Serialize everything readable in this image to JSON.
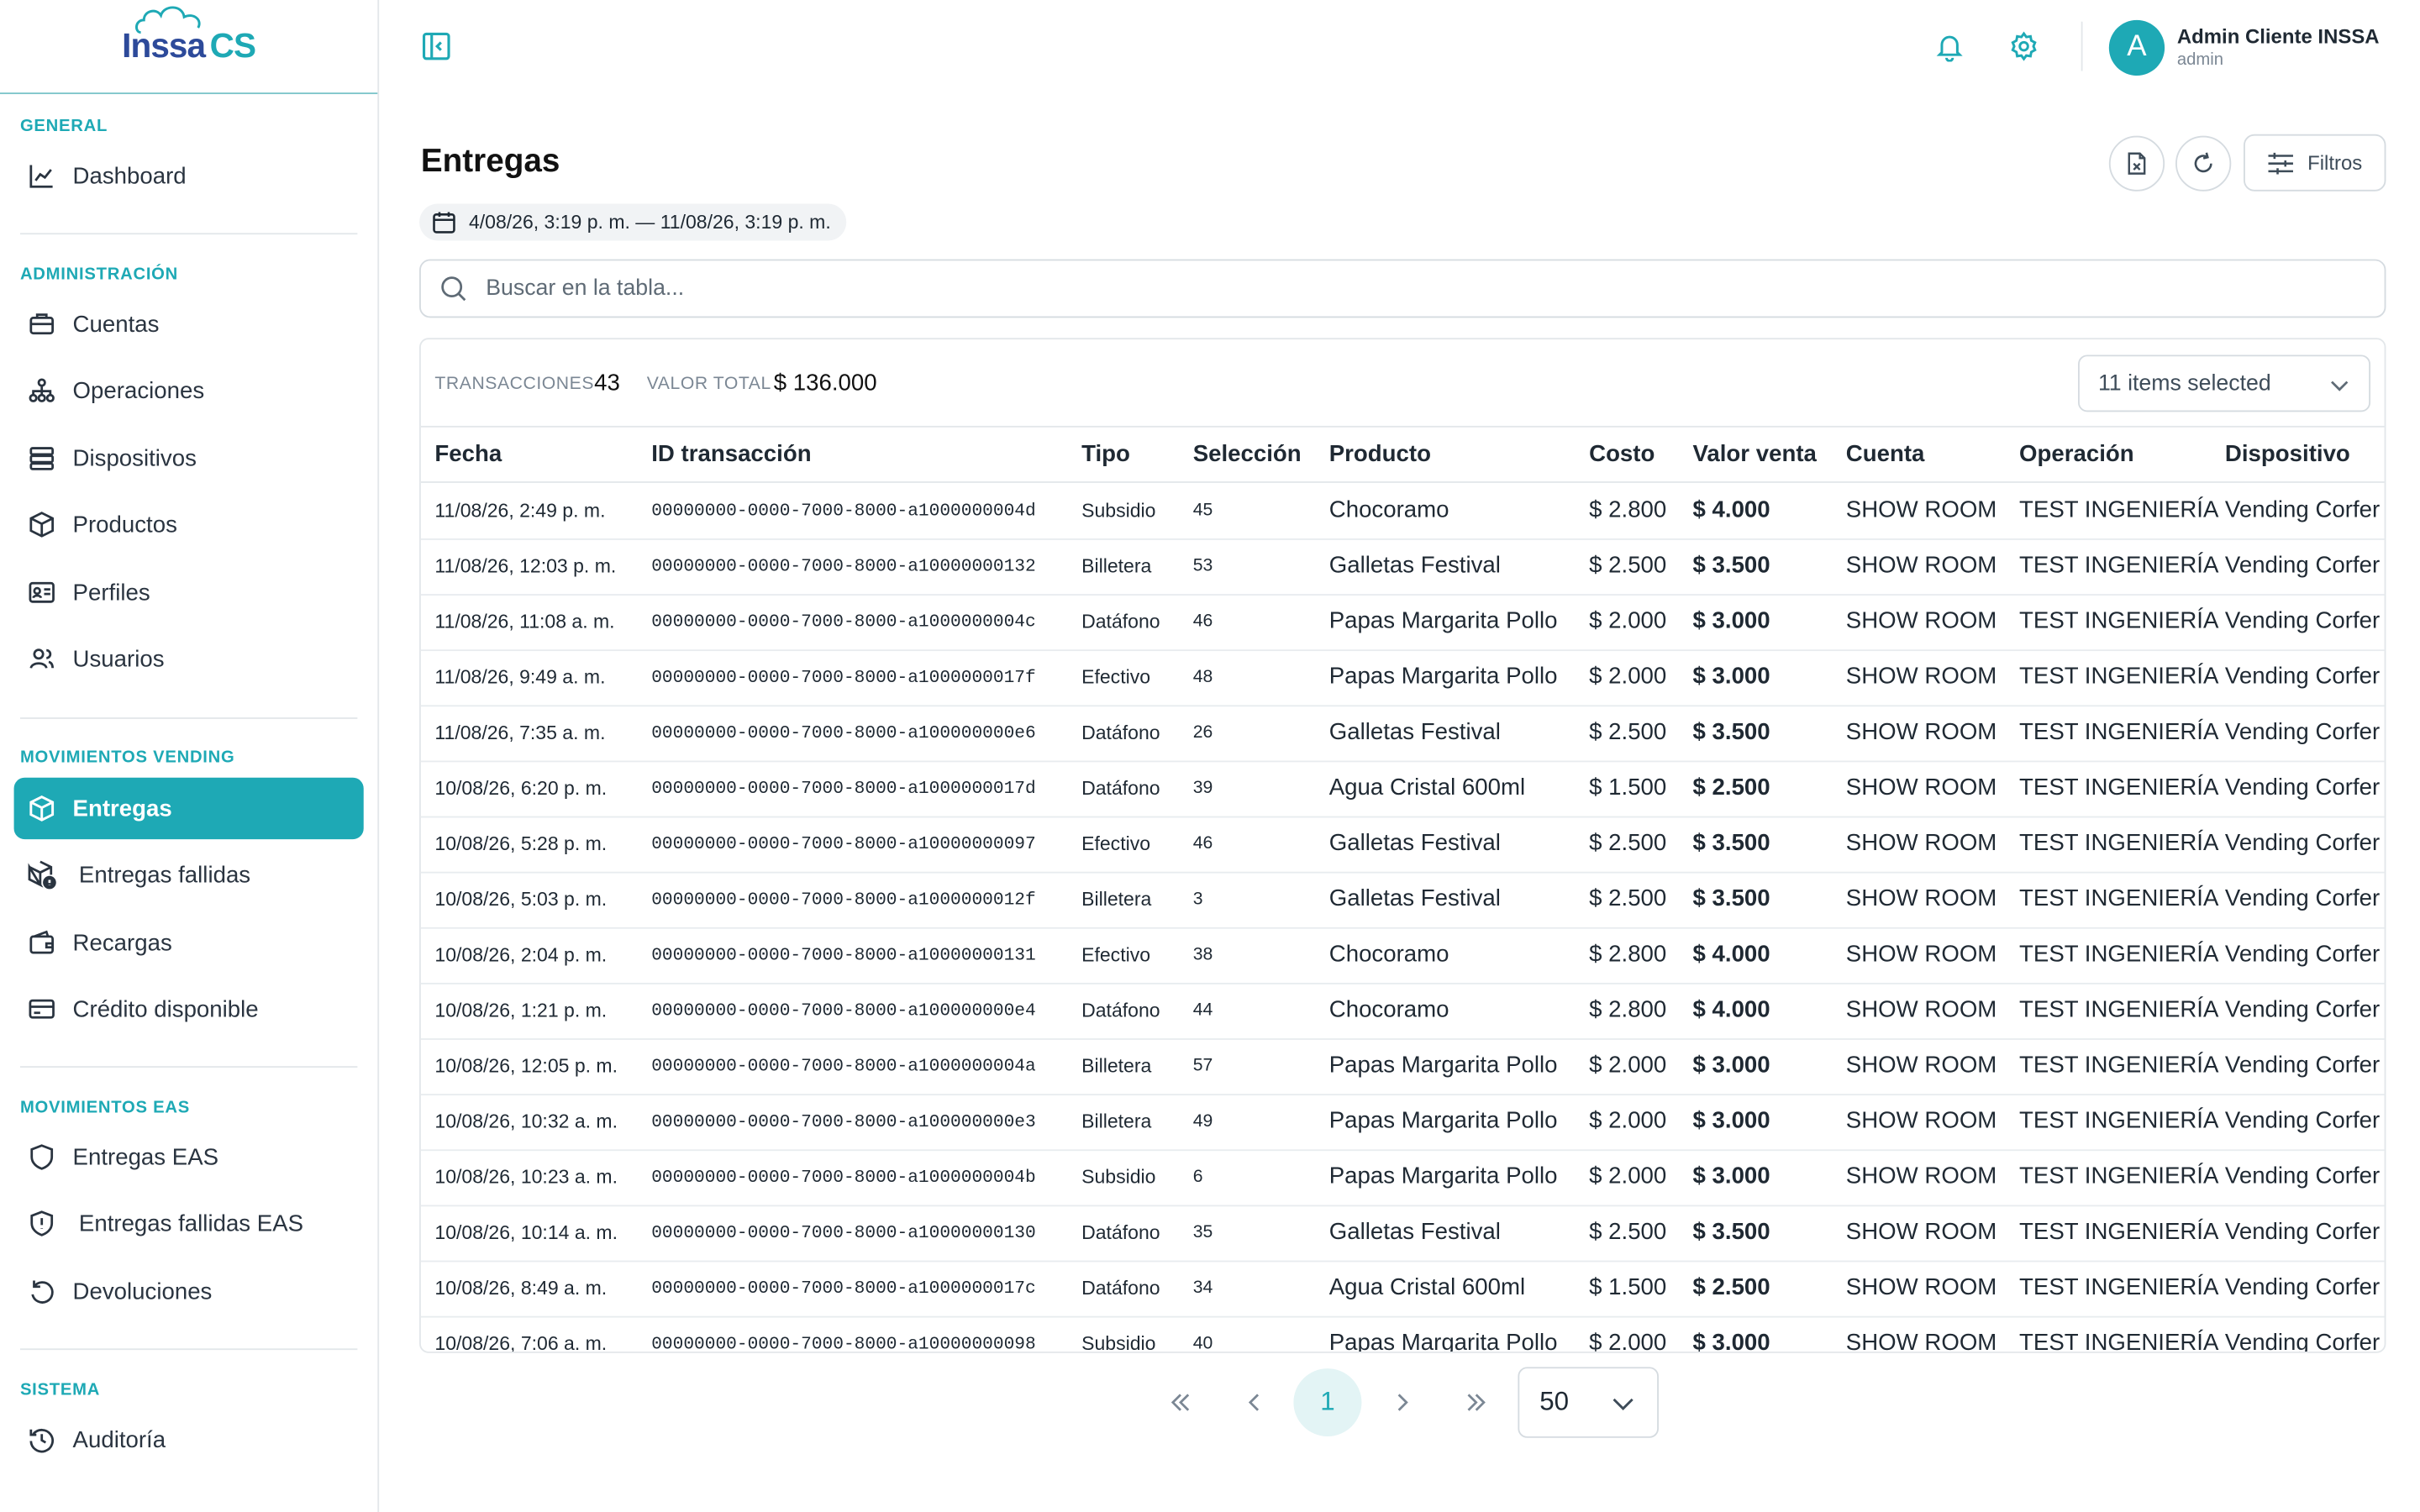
{
  "brand": {
    "name_main": "Inssa",
    "name_accent": "CS",
    "accent": "#1ea9b5"
  },
  "sidebar": {
    "sections": [
      {
        "label": "GENERAL"
      },
      {
        "label": "ADMINISTRACIÓN"
      },
      {
        "label": "MOVIMIENTOS VENDING"
      },
      {
        "label": "MOVIMIENTOS EAS"
      },
      {
        "label": "SISTEMA"
      }
    ],
    "items": [
      {
        "label": "Dashboard",
        "icon": "chart-line-icon"
      },
      {
        "label": "Cuentas",
        "icon": "briefcase-icon"
      },
      {
        "label": "Operaciones",
        "icon": "hierarchy-icon"
      },
      {
        "label": "Dispositivos",
        "icon": "server-icon"
      },
      {
        "label": "Productos",
        "icon": "box-icon"
      },
      {
        "label": "Perfiles",
        "icon": "id-card-icon"
      },
      {
        "label": "Usuarios",
        "icon": "users-icon"
      },
      {
        "label": "Entregas",
        "icon": "box-icon",
        "active": true
      },
      {
        "label": "Entregas fallidas",
        "icon": "box-alert-icon"
      },
      {
        "label": "Recargas",
        "icon": "wallet-icon"
      },
      {
        "label": "Crédito disponible",
        "icon": "credit-card-icon"
      },
      {
        "label": "Entregas EAS",
        "icon": "shield-icon"
      },
      {
        "label": "Entregas fallidas EAS",
        "icon": "shield-alert-icon"
      },
      {
        "label": "Devoluciones",
        "icon": "undo-icon"
      },
      {
        "label": "Auditoría",
        "icon": "history-icon"
      }
    ]
  },
  "header": {
    "user_name": "Admin Cliente INSSA",
    "user_role": "admin",
    "avatar_letter": "A"
  },
  "page": {
    "title": "Entregas",
    "date_range": "4/08/26, 3:19 p. m. — 11/08/26, 3:19 p. m.",
    "filters_label": "Filtros",
    "search_placeholder": "Buscar en la tabla..."
  },
  "summary": {
    "transactions_label": "TRANSACCIONES",
    "transactions_value": "43",
    "total_label": "VALOR TOTAL",
    "total_value": "$ 136.000",
    "columns_selector": "11 items selected"
  },
  "table": {
    "headers": [
      "Fecha",
      "ID transacción",
      "Tipo",
      "Selección",
      "Producto",
      "Costo",
      "Valor venta",
      "Cuenta",
      "Operación",
      "Dispositivo"
    ],
    "rows": [
      [
        "11/08/26, 2:49 p. m.",
        "00000000-0000-7000-8000-a1000000004d",
        "Subsidio",
        "45",
        "Chocoramo",
        "$ 2.800",
        "$ 4.000",
        "SHOW ROOM",
        "TEST INGENIERÍA",
        "Vending Corfer"
      ],
      [
        "11/08/26, 12:03 p. m.",
        "00000000-0000-7000-8000-a10000000132",
        "Billetera",
        "53",
        "Galletas Festival",
        "$ 2.500",
        "$ 3.500",
        "SHOW ROOM",
        "TEST INGENIERÍA",
        "Vending Corfer"
      ],
      [
        "11/08/26, 11:08 a. m.",
        "00000000-0000-7000-8000-a1000000004c",
        "Datáfono",
        "46",
        "Papas Margarita Pollo",
        "$ 2.000",
        "$ 3.000",
        "SHOW ROOM",
        "TEST INGENIERÍA",
        "Vending Corfer"
      ],
      [
        "11/08/26, 9:49 a. m.",
        "00000000-0000-7000-8000-a1000000017f",
        "Efectivo",
        "48",
        "Papas Margarita Pollo",
        "$ 2.000",
        "$ 3.000",
        "SHOW ROOM",
        "TEST INGENIERÍA",
        "Vending Corfer"
      ],
      [
        "11/08/26, 7:35 a. m.",
        "00000000-0000-7000-8000-a100000000e6",
        "Datáfono",
        "26",
        "Galletas Festival",
        "$ 2.500",
        "$ 3.500",
        "SHOW ROOM",
        "TEST INGENIERÍA",
        "Vending Corfer"
      ],
      [
        "10/08/26, 6:20 p. m.",
        "00000000-0000-7000-8000-a1000000017d",
        "Datáfono",
        "39",
        "Agua Cristal 600ml",
        "$ 1.500",
        "$ 2.500",
        "SHOW ROOM",
        "TEST INGENIERÍA",
        "Vending Corfer"
      ],
      [
        "10/08/26, 5:28 p. m.",
        "00000000-0000-7000-8000-a10000000097",
        "Efectivo",
        "46",
        "Galletas Festival",
        "$ 2.500",
        "$ 3.500",
        "SHOW ROOM",
        "TEST INGENIERÍA",
        "Vending Corfer"
      ],
      [
        "10/08/26, 5:03 p. m.",
        "00000000-0000-7000-8000-a1000000012f",
        "Billetera",
        "3",
        "Galletas Festival",
        "$ 2.500",
        "$ 3.500",
        "SHOW ROOM",
        "TEST INGENIERÍA",
        "Vending Corfer"
      ],
      [
        "10/08/26, 2:04 p. m.",
        "00000000-0000-7000-8000-a10000000131",
        "Efectivo",
        "38",
        "Chocoramo",
        "$ 2.800",
        "$ 4.000",
        "SHOW ROOM",
        "TEST INGENIERÍA",
        "Vending Corfer"
      ],
      [
        "10/08/26, 1:21 p. m.",
        "00000000-0000-7000-8000-a100000000e4",
        "Datáfono",
        "44",
        "Chocoramo",
        "$ 2.800",
        "$ 4.000",
        "SHOW ROOM",
        "TEST INGENIERÍA",
        "Vending Corfer"
      ],
      [
        "10/08/26, 12:05 p. m.",
        "00000000-0000-7000-8000-a1000000004a",
        "Billetera",
        "57",
        "Papas Margarita Pollo",
        "$ 2.000",
        "$ 3.000",
        "SHOW ROOM",
        "TEST INGENIERÍA",
        "Vending Corfer"
      ],
      [
        "10/08/26, 10:32 a. m.",
        "00000000-0000-7000-8000-a100000000e3",
        "Billetera",
        "49",
        "Papas Margarita Pollo",
        "$ 2.000",
        "$ 3.000",
        "SHOW ROOM",
        "TEST INGENIERÍA",
        "Vending Corfer"
      ],
      [
        "10/08/26, 10:23 a. m.",
        "00000000-0000-7000-8000-a1000000004b",
        "Subsidio",
        "6",
        "Papas Margarita Pollo",
        "$ 2.000",
        "$ 3.000",
        "SHOW ROOM",
        "TEST INGENIERÍA",
        "Vending Corfer"
      ],
      [
        "10/08/26, 10:14 a. m.",
        "00000000-0000-7000-8000-a10000000130",
        "Datáfono",
        "35",
        "Galletas Festival",
        "$ 2.500",
        "$ 3.500",
        "SHOW ROOM",
        "TEST INGENIERÍA",
        "Vending Corfer"
      ],
      [
        "10/08/26, 8:49 a. m.",
        "00000000-0000-7000-8000-a1000000017c",
        "Datáfono",
        "34",
        "Agua Cristal 600ml",
        "$ 1.500",
        "$ 2.500",
        "SHOW ROOM",
        "TEST INGENIERÍA",
        "Vending Corfer"
      ],
      [
        "10/08/26, 7:06 a. m.",
        "00000000-0000-7000-8000-a10000000098",
        "Subsidio",
        "40",
        "Papas Margarita Pollo",
        "$ 2.000",
        "$ 3.000",
        "SHOW ROOM",
        "TEST INGENIERÍA",
        "Vending Corfer"
      ]
    ]
  },
  "pagination": {
    "current_page": "1",
    "page_size": "50"
  }
}
